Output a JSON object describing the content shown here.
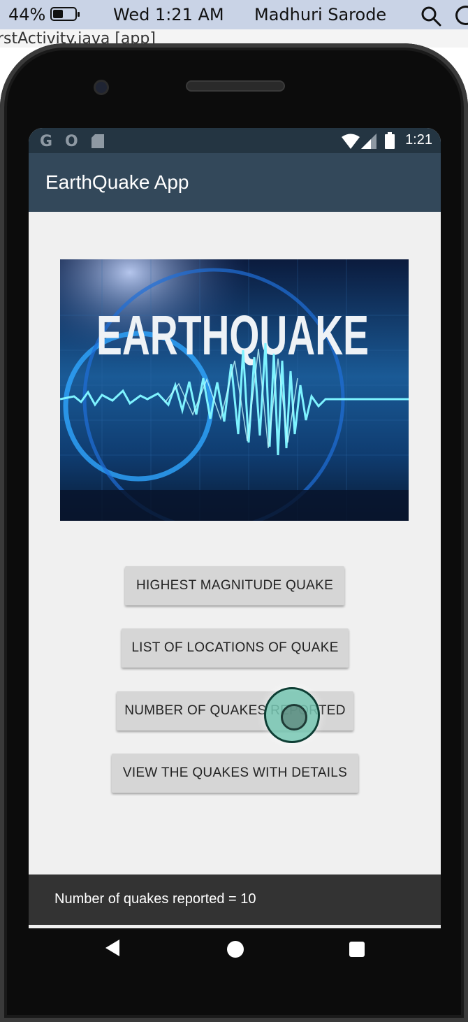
{
  "mac_menubar": {
    "battery_percent": "44%",
    "clock": "Wed 1:21 AM",
    "user": "Madhuri Sarode"
  },
  "ide": {
    "tab_title": "rstActivity.java [app]"
  },
  "status_bar": {
    "notification_icons": [
      "G",
      "O",
      "sd-card-icon"
    ],
    "time": "1:21"
  },
  "app_bar": {
    "title": "EarthQuake App"
  },
  "banner": {
    "text": "EARTHQUAKE"
  },
  "buttons": [
    "HIGHEST MAGNITUDE QUAKE",
    "LIST OF LOCATIONS OF QUAKE",
    "NUMBER OF QUAKES REPORTED",
    "VIEW THE QUAKES WITH DETAILS"
  ],
  "snackbar": {
    "message": "Number of quakes reported = 10"
  },
  "colors": {
    "status_bar": "#243542",
    "app_bar": "#33485a",
    "button": "#d6d6d6",
    "snackbar": "#333333"
  }
}
